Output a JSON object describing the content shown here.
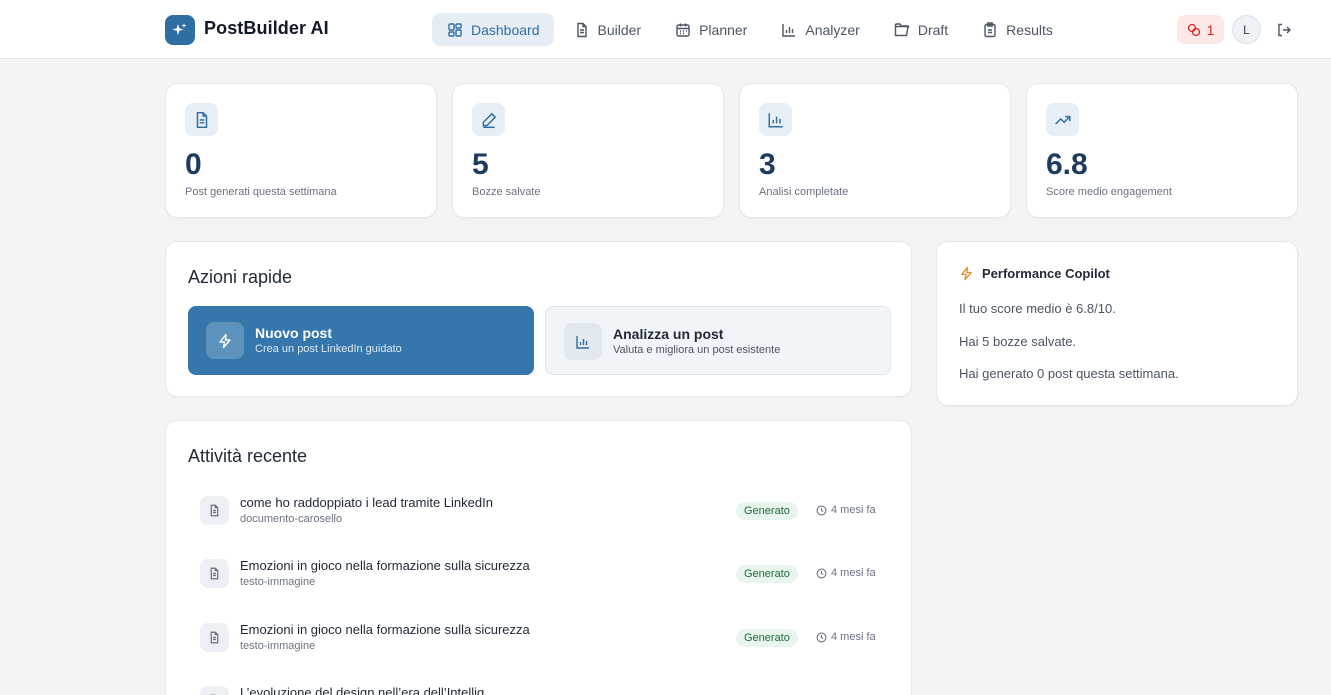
{
  "app": {
    "brand": "PostBuilder AI"
  },
  "nav": {
    "items": [
      {
        "label": "Dashboard",
        "icon": "dashboard-icon",
        "active": true
      },
      {
        "label": "Builder",
        "icon": "document-icon"
      },
      {
        "label": "Planner",
        "icon": "calendar-icon"
      },
      {
        "label": "Analyzer",
        "icon": "bar-chart-icon"
      },
      {
        "label": "Draft",
        "icon": "folder-icon"
      },
      {
        "label": "Results",
        "icon": "clipboard-icon"
      }
    ]
  },
  "header": {
    "credits": "1",
    "avatar_initial": "L"
  },
  "stats": [
    {
      "value": "0",
      "label": "Post generati questa settimana",
      "icon": "document-icon"
    },
    {
      "value": "5",
      "label": "Bozze salvate",
      "icon": "pencil-icon"
    },
    {
      "value": "3",
      "label": "Analisi completate",
      "icon": "bar-chart-icon"
    },
    {
      "value": "6.8",
      "label": "Score medio engagement",
      "icon": "trending-up-icon"
    }
  ],
  "quick_actions": {
    "title": "Azioni rapide",
    "items": [
      {
        "title": "Nuovo post",
        "subtitle": "Crea un post LinkedIn guidato",
        "icon": "bolt-icon"
      },
      {
        "title": "Analizza un post",
        "subtitle": "Valuta e migliora un post esistente",
        "icon": "bar-chart-icon"
      }
    ]
  },
  "copilot": {
    "title": "Performance Copilot",
    "lines": [
      "Il tuo score medio è 6.8/10.",
      "Hai 5 bozze salvate.",
      "Hai generato 0 post questa settimana."
    ]
  },
  "recent": {
    "title": "Attività recente",
    "items": [
      {
        "title": "come ho raddoppiato i lead tramite LinkedIn",
        "subtitle": "documento-carosello",
        "badge": "Generato",
        "time": "4 mesi fa"
      },
      {
        "title": "Emozioni in gioco nella formazione sulla sicurezza",
        "subtitle": "testo-immagine",
        "badge": "Generato",
        "time": "4 mesi fa"
      },
      {
        "title": "Emozioni in gioco nella formazione sulla sicurezza",
        "subtitle": "testo-immagine",
        "badge": "Generato",
        "time": "4 mesi fa"
      },
      {
        "title": "L’evoluzione del design nell’era dell’Intellig…",
        "subtitle": "",
        "badge": "",
        "time": ""
      }
    ]
  },
  "colors": {
    "accent": "#3577ac",
    "navy": "#1f3a5f",
    "success_bg": "#e8f5ec",
    "danger": "#dc2626"
  }
}
